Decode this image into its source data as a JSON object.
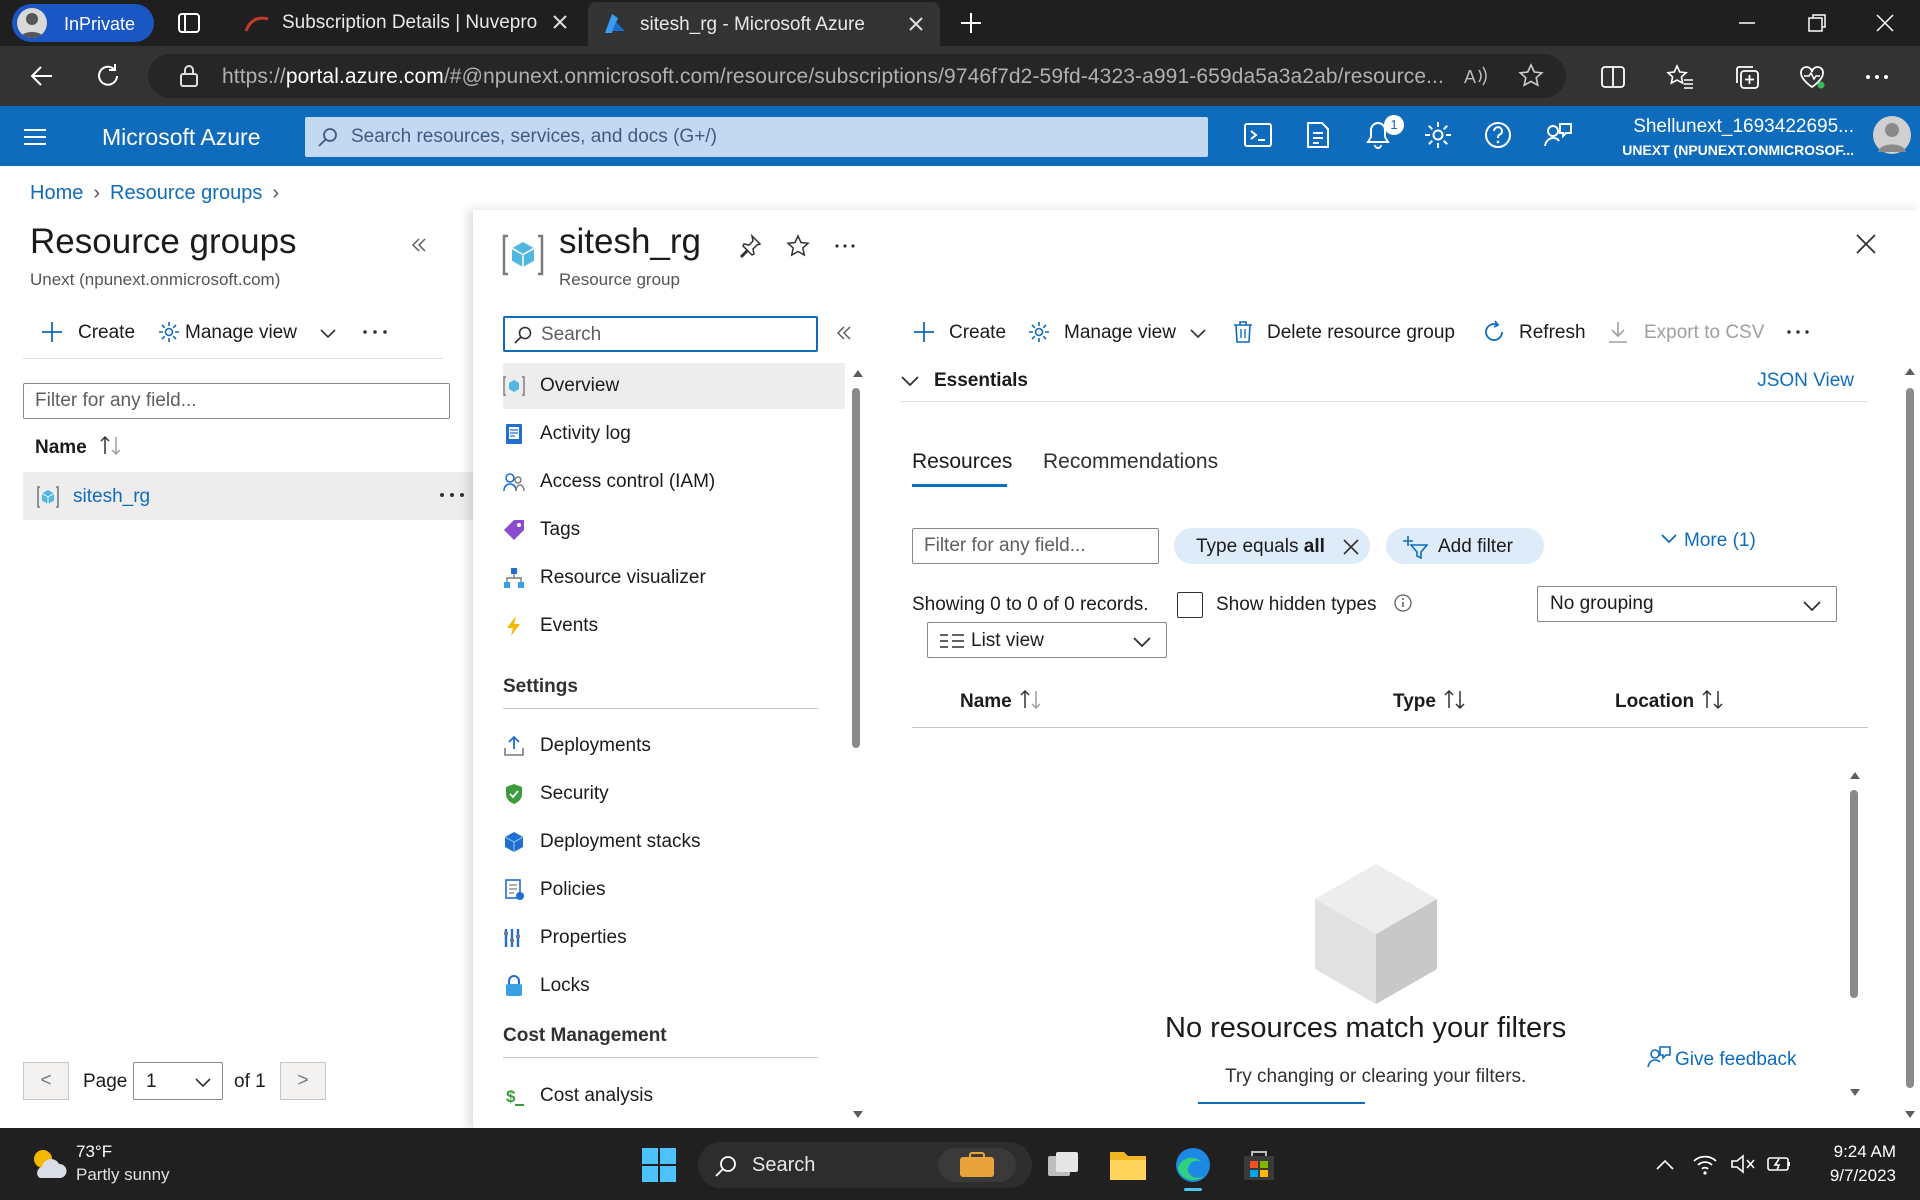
{
  "browser": {
    "badge": "InPrivate",
    "tabs": [
      {
        "title": "Subscription Details | Nuvepro"
      },
      {
        "title": "sitesh_rg - Microsoft Azure"
      }
    ],
    "url_prefix": "https://",
    "url_host": "portal.azure.com",
    "url_rest": "/#@npunext.onmicrosoft.com/resource/subscriptions/9746f7d2-59fd-4323-a991-659da5a3a2ab/resource..."
  },
  "azure": {
    "brand": "Microsoft Azure",
    "search_placeholder": "Search resources, services, and docs (G+/)",
    "notification_count": "1",
    "account_name": "Shellunext_1693422695...",
    "account_tenant": "UNEXT (NPUNEXT.ONMICROSOF..."
  },
  "breadcrumb": [
    "Home",
    "Resource groups"
  ],
  "left_pane": {
    "title": "Resource groups",
    "subtitle": "Unext (npunext.onmicrosoft.com)",
    "create": "Create",
    "manage_view": "Manage view",
    "filter_placeholder": "Filter for any field...",
    "col_name": "Name",
    "rows": [
      {
        "name": "sitesh_rg"
      }
    ],
    "pager": {
      "prev": "<",
      "label": "Page",
      "value": "1",
      "of": "of 1",
      "next": ">"
    }
  },
  "resource": {
    "title": "sitesh_rg",
    "subtitle": "Resource group",
    "menu_search_placeholder": "Search",
    "menu": [
      {
        "label": "Overview"
      },
      {
        "label": "Activity log"
      },
      {
        "label": "Access control (IAM)"
      },
      {
        "label": "Tags"
      },
      {
        "label": "Resource visualizer"
      },
      {
        "label": "Events"
      }
    ],
    "settings_header": "Settings",
    "settings": [
      {
        "label": "Deployments"
      },
      {
        "label": "Security"
      },
      {
        "label": "Deployment stacks"
      },
      {
        "label": "Policies"
      },
      {
        "label": "Properties"
      },
      {
        "label": "Locks"
      }
    ],
    "cost_header": "Cost Management",
    "cost": [
      {
        "label": "Cost analysis"
      }
    ],
    "toolbar": {
      "create": "Create",
      "manage_view": "Manage view",
      "delete": "Delete resource group",
      "refresh": "Refresh",
      "export": "Export to CSV"
    },
    "essentials": "Essentials",
    "json_view": "JSON View",
    "tabs": [
      "Resources",
      "Recommendations"
    ],
    "filter_placeholder": "Filter for any field...",
    "type_filter_prefix": "Type equals ",
    "type_filter_value": "all",
    "add_filter": "Add filter",
    "more": "More (1)",
    "showing": "Showing 0 to 0 of 0 records.",
    "show_hidden": "Show hidden types",
    "grouping": "No grouping",
    "list_view": "List view",
    "columns": [
      "Name",
      "Type",
      "Location"
    ],
    "empty_title": "No resources match your filters",
    "empty_sub": "Try changing or clearing your filters.",
    "feedback": "Give feedback"
  },
  "taskbar": {
    "temp": "73°F",
    "weather": "Partly sunny",
    "search": "Search",
    "time": "9:24 AM",
    "date": "9/7/2023"
  },
  "colors": {
    "azure_blue": "#0f6cbd",
    "tab_bg": "#1f1f1f",
    "inprivate": "#1a56c4"
  }
}
